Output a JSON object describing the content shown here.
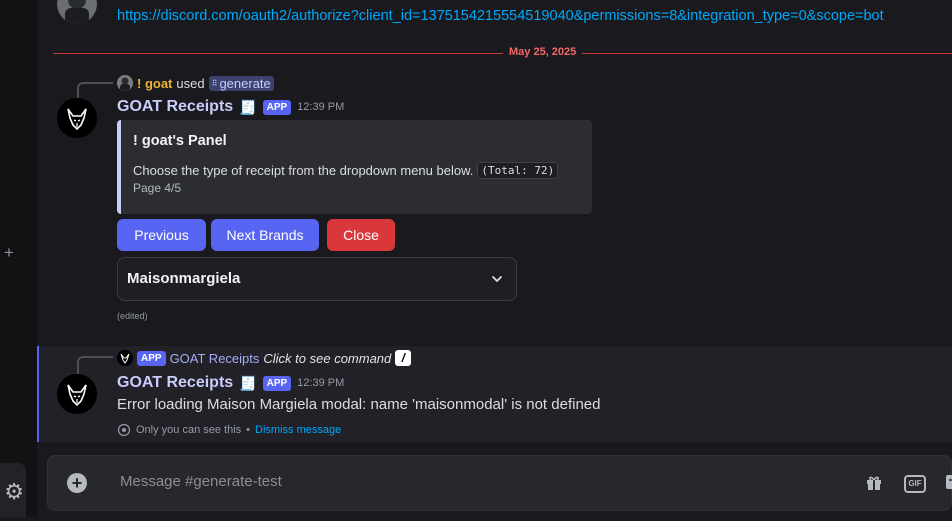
{
  "previous_message": {
    "link": "https://discord.com/oauth2/authorize?client_id=1375154215554519040&permissions=8&integration_type=0&scope=bot"
  },
  "date_divider": "May 25, 2025",
  "message1": {
    "reply": {
      "user": "! goat",
      "verb": "used",
      "command": "generate"
    },
    "author": "GOAT Receipts",
    "badge": "APP",
    "time": "12:39 PM",
    "embed": {
      "title": "! goat's Panel",
      "description": "Choose the type of receipt from the dropdown menu below.",
      "code": "(Total: 72)",
      "footer": "Page 4/5"
    },
    "buttons": {
      "previous": "Previous",
      "next": "Next Brands",
      "close": "Close"
    },
    "select": {
      "value": "Maisonmargiela"
    },
    "edited": "(edited)"
  },
  "message2": {
    "reply": {
      "badge": "APP",
      "author": "GOAT Receipts",
      "command_hint": "Click to see command"
    },
    "author": "GOAT Receipts",
    "badge": "APP",
    "time": "12:39 PM",
    "text": "Error loading Maison Margiela modal: name 'maisonmodal' is not defined",
    "footer": {
      "note": "Only you can see this",
      "separator": "•",
      "dismiss": "Dismiss message"
    }
  },
  "composer": {
    "placeholder": "Message #generate-test"
  },
  "icons": {
    "sidebar_add": "plus-icon",
    "settings": "gear-icon",
    "composer_add": "add-circle-icon",
    "gift": "gift-icon",
    "gif": "gif-icon",
    "sticker": "sticker-icon"
  },
  "colors": {
    "blurple": "#5865f2",
    "danger": "#da373c",
    "link": "#00a8fc",
    "divider": "#c43a3a"
  }
}
